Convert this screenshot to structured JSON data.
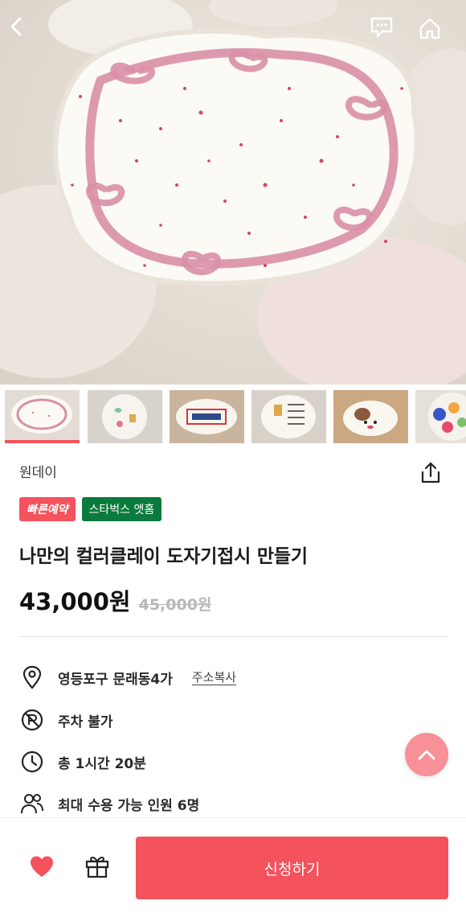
{
  "hero": {
    "image": "pink ribbon painted ceramic plate",
    "icons": {
      "back": "back-arrow-icon",
      "chat": "chat-bubble-icon",
      "home": "home-icon"
    }
  },
  "thumbnails": [
    {
      "name": "thumb-ribbon-plate",
      "active": true
    },
    {
      "name": "thumb-doodle-plate",
      "active": false
    },
    {
      "name": "thumb-name-plate",
      "active": false
    },
    {
      "name": "thumb-calendar-plate",
      "active": false
    },
    {
      "name": "thumb-dog-plate",
      "active": false
    },
    {
      "name": "thumb-colorful-plate",
      "active": false
    }
  ],
  "product": {
    "studio": "원데이",
    "badges": {
      "quick": "빠른예약",
      "starbucks": "스타벅스 앳홈"
    },
    "title": "나만의 컬러클레이 도자기접시 만들기",
    "price": "43,000원",
    "original_price": "45,000원"
  },
  "info": {
    "address": "영등포구 문래동4가",
    "copy_address": "주소복사",
    "parking": "주차 불가",
    "duration": "총 1시간 20분",
    "capacity": "최대 수용 가능 인원 6명"
  },
  "cta": {
    "apply_label": "신청하기"
  },
  "colors": {
    "accent": "#f4525c",
    "green_badge": "#0b7a3e",
    "scroll_top": "#f79097"
  }
}
